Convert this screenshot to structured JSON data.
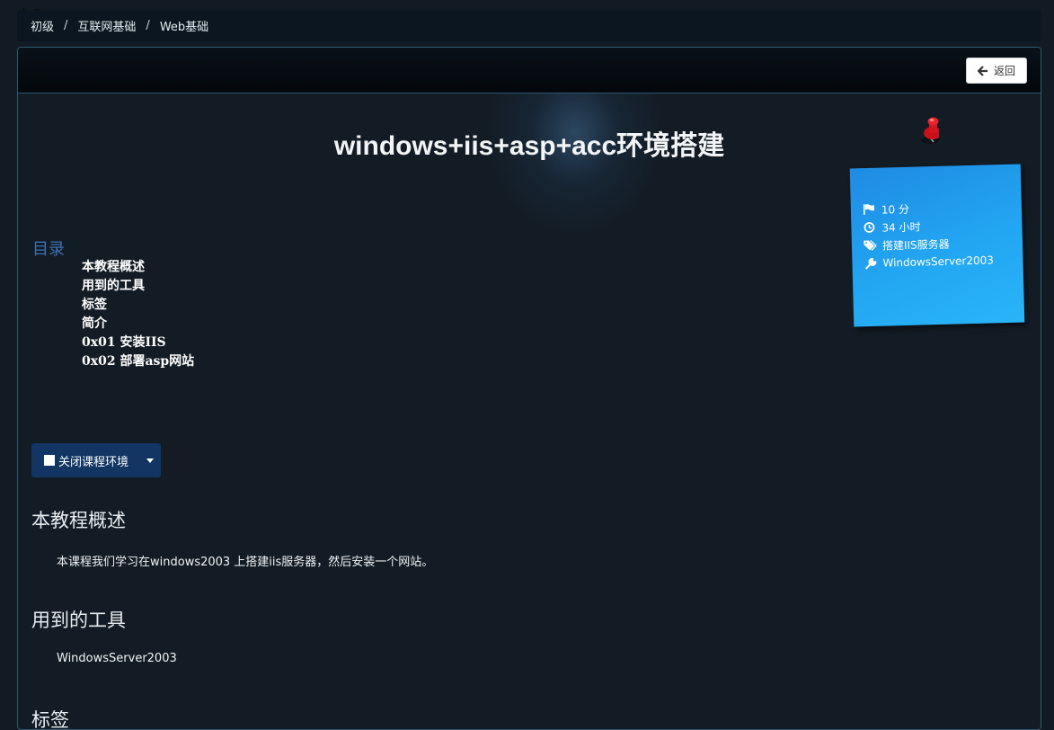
{
  "breadcrumb": {
    "items": [
      "初级",
      "互联网基础",
      "Web基础"
    ],
    "separator": "/"
  },
  "header": {
    "back_label": "返回"
  },
  "title": "windows+iis+asp+acc环境搭建",
  "note": {
    "score": "10 分",
    "duration": "34 小时",
    "tag": "搭建IIS服务器",
    "tool": "WindowsServer2003",
    "icons": [
      "flag-icon",
      "clock-icon",
      "tags-icon",
      "wrench-icon"
    ]
  },
  "toc": {
    "title": "目录",
    "items": [
      "本教程概述",
      "用到的工具",
      "标签",
      "简介",
      "0x01 安装IIS",
      "0x02 部署asp网站"
    ]
  },
  "env_button": {
    "label": "关闭课程环境"
  },
  "sections": {
    "overview": {
      "heading": "本教程概述",
      "text": "本课程我们学习在windows2003 上搭建iis服务器，然后安装一个网站。"
    },
    "tools": {
      "heading": "用到的工具",
      "text": "WindowsServer2003"
    },
    "tags": {
      "heading": "标签"
    }
  },
  "colors": {
    "background": "#131c25",
    "panel_border": "#2d5a72",
    "note_blue": "#22a6f2",
    "toc_title": "#3f6fb4",
    "button_blue": "#123563"
  }
}
